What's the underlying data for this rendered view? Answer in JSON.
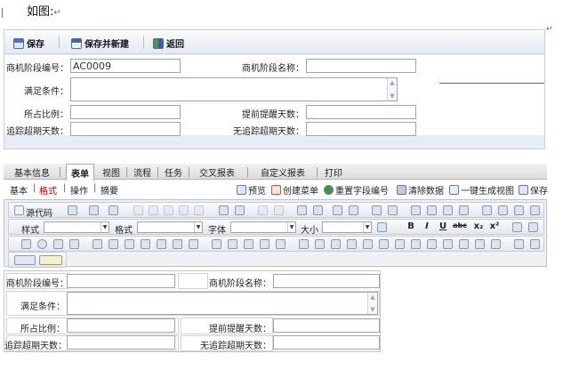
{
  "caption": {
    "text": "如图:",
    "return_mark": "↵"
  },
  "toolbar": {
    "save": "保存",
    "save_new": "保存并新建",
    "back": "返回"
  },
  "form": {
    "code_label": "商机阶段编号：",
    "code_value": "AC0009",
    "name_label": "商机阶段名称：",
    "condition_label": "满足条件：",
    "ratio_label": "所占比例：",
    "remind_label": "提前提醒天数：",
    "overdue_label": "追踪超期天数：",
    "notrack_label": "无追踪超期天数："
  },
  "tabs": [
    "基本信息",
    "表单",
    "视图",
    "流程",
    "任务",
    "交叉报表",
    "自定义报表",
    "打印"
  ],
  "active_tab": "表单",
  "subtabs": [
    "基本",
    "格式",
    "操作",
    "摘要"
  ],
  "active_subtab": "格式",
  "actions": {
    "preview": "预览",
    "create_menu": "创建菜单",
    "reset_code": "重置字段编号",
    "clear_data": "清除数据",
    "gen_view": "一键生成视图",
    "save": "保存"
  },
  "editor": {
    "source": "源代码",
    "style": "样式",
    "format": "格式",
    "font": "字体",
    "size": "大小",
    "bold": "B",
    "italic": "I",
    "underline": "U",
    "strike": "abc",
    "sub": "x₂",
    "sup": "x²"
  },
  "preview_form": {
    "code_label": "商机阶段编号：",
    "name_label": "商机阶段名称：",
    "condition_label": "满足条件：",
    "ratio_label": "所占比例：",
    "remind_label": "提前提醒天数：",
    "overdue_label": "追踪超期天数：",
    "notrack_label": "无追踪超期天数："
  },
  "colors": {
    "accent": "#4a6fa8",
    "active_subtab": "#c00000"
  }
}
